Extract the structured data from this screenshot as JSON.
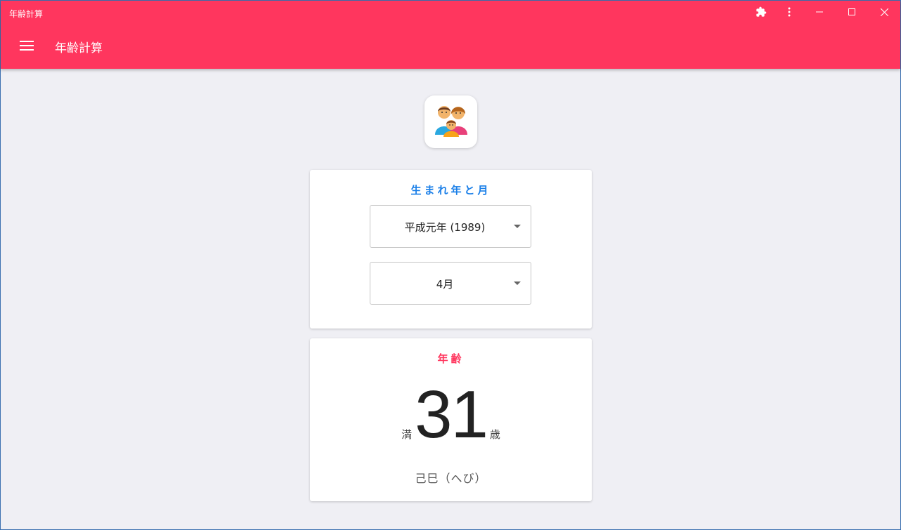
{
  "window": {
    "title": "年齢計算"
  },
  "appbar": {
    "title": "年齢計算",
    "color": "#ff365e"
  },
  "icons": {
    "extension": "puzzle-icon",
    "more": "more-vert-icon",
    "menu": "hamburger-menu-icon",
    "app": "family-icon"
  },
  "birth_card": {
    "title": "生まれ年と月",
    "year_select": {
      "value": "平成元年 (1989)"
    },
    "month_select": {
      "value": "4月"
    }
  },
  "age_card": {
    "title": "年齢",
    "prefix": "満",
    "age": "31",
    "suffix": "歳",
    "zodiac": "己巳（へび）"
  },
  "colors": {
    "accent_blue": "#1a7fe8",
    "accent_red": "#ff365e",
    "background": "#efeff4"
  }
}
